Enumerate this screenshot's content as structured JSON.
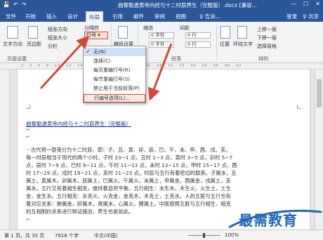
{
  "titlebar": {
    "title": "曲黎勒遗黄帝内经与十二时辰养生（完整版）.docx [兼容...",
    "qa_save": "💾",
    "qa_undo": "↶",
    "qa_redo": "↷",
    "min": "—",
    "max": "☐",
    "close": "✕"
  },
  "tabs": {
    "file": "文件",
    "home": "开始",
    "insert": "插入",
    "design": "设计",
    "layout": "布局",
    "references": "引用",
    "mailings": "邮件",
    "review": "审阅",
    "view": "视图",
    "tell": "♀ 告诉...",
    "login": "登录",
    "share": "♀ 共享"
  },
  "ribbon": {
    "text_direction": "文字方向",
    "margins": "页边距",
    "orientation": "纸张方向",
    "size": "纸张大小",
    "columns": "分栏",
    "breaks": "分隔符",
    "line_numbers": "行号",
    "hyphenation": "断字",
    "group_page_setup": "页面设置",
    "draft_paper": "稿纸设置",
    "group_draft": "稿纸",
    "indent_label": "缩进",
    "indent_left": "0 字符",
    "indent_right": "0 字符",
    "spacing_label": "间距",
    "spacing_before": "0 行",
    "spacing_after": "0 行",
    "group_paragraph": "段落",
    "position": "位置",
    "wrap_text": "环绕文字",
    "bring_forward": "上移一层",
    "send_backward": "下移一层",
    "selection_pane": "选择窗格",
    "group_arrange": "排列"
  },
  "ruler_marks": "2 · 4 · 6 · 8 · 10 · 12 · 14 · 16 · 18 · 20 · 22 · 24 · 26 · 28 · 30 · 32 · 34 · 36 · 38 · 40 · 42",
  "dropdown": {
    "items": [
      {
        "label": "无(N)",
        "checked": true
      },
      {
        "label": "连续(C)",
        "checked": false
      },
      {
        "label": "每页重编行号(R)",
        "checked": false
      },
      {
        "label": "每节重编行号(S)",
        "checked": false
      },
      {
        "label": "禁止用于当前段落(P)",
        "checked": false
      },
      {
        "label": "行编号选项(L)...",
        "checked": false
      }
    ]
  },
  "document": {
    "title": "曲黎勒遗黄帝内经与十二时辰养生（完整版）",
    "lines": [
      "···古代将一昼夜分为十二时辰，即：子、丑、寅、卯、辰、巳、午、未、申、酉、戌、亥。",
      "每一时辰相当于现代的两个小时。子时 23~1 点，丑时 1~3 点，寅时 3~5 点，卯时 5~7",
      "点，辰时 7~9 点，巳时 9~11 点，午时 11~13 点，未时 13~15 点，申时 15~17 点，酉",
      "时 17~19 点，戌时 19~21 点，亥时 21~23 点。时辰与五行有着密切的联系。子属水，丑",
      "属土，寅属木，卯属木，辰属土，巳属火，午属火，未属土，申属金，酉属金，戌属土，亥",
      "属水。五行又有着相生相克，维持着自然平衡。五行相生：水生木，木生火，火生土，土生",
      "金，金生水。五行相克：水克火，火克金，金克木，木克土，土克水。人的五脏与五行也有",
      "着对应关系：肺属金，肝属木，肾属水，心属火，脾属土。中医按照五脏与五行相生，相克",
      "的互相制约关系进行辨证施治，养生也是如此。"
    ]
  },
  "statusbar": {
    "page": "第 1 页，共 35 页",
    "words": "7816 个字",
    "lang": "中文(中国)",
    "zoom": "100%"
  },
  "watermark": {
    "text": "最需教育"
  },
  "colors": {
    "title_bar": "#2b579a",
    "annotation_red": "#d04a3a",
    "watermark_blue": "#2466b8"
  }
}
